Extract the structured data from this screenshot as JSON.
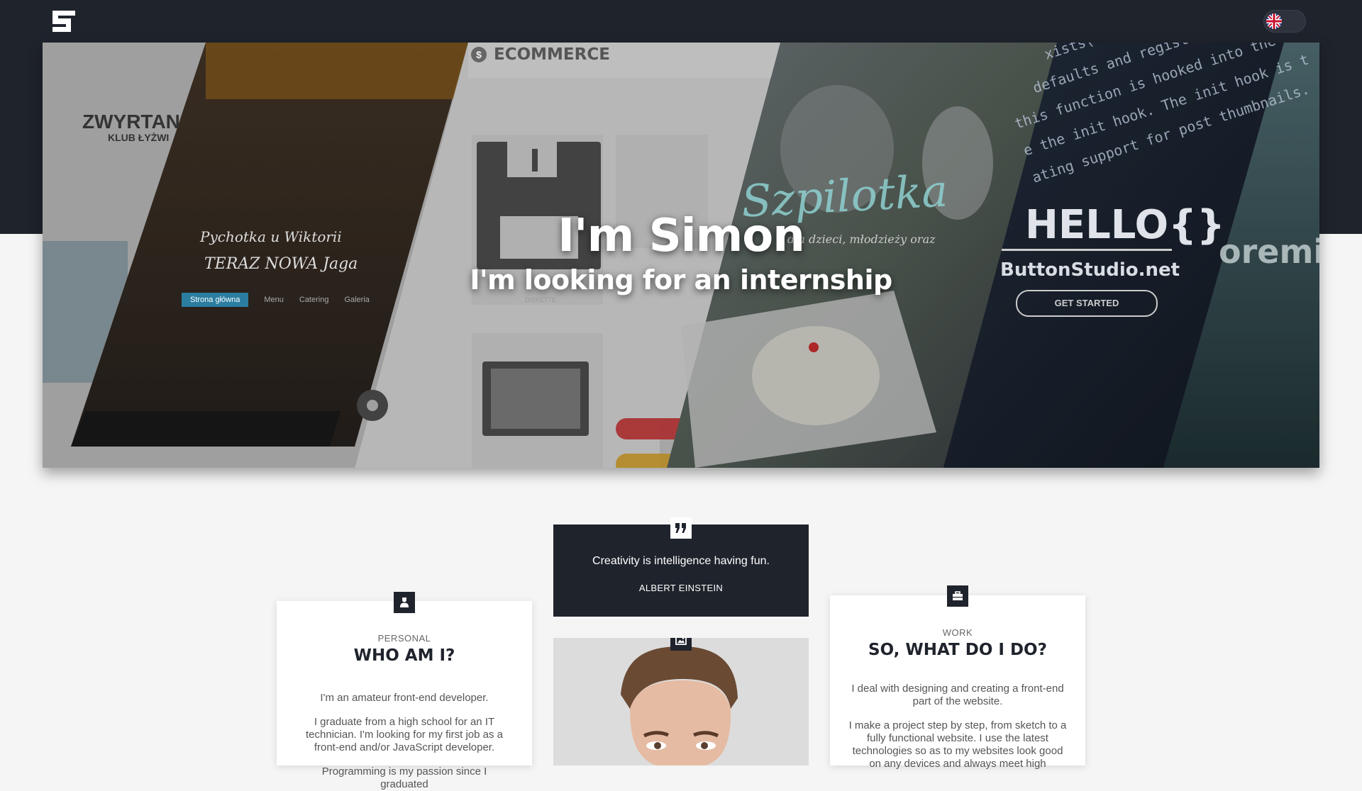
{
  "header": {
    "logo_icon": "g-logo-icon",
    "language_toggle": {
      "flag_icon": "uk-flag-icon"
    }
  },
  "hero": {
    "title": "I'm Simon",
    "subtitle": "I'm looking for an internship",
    "panels": {
      "zwyrtan": {
        "title": "ZWYRTAN",
        "subtitle": "KLUB ŁYŻWI",
        "script1": "Pychotka u Wiktorii",
        "script2": "TERAZ NOWA Jaga",
        "menu": [
          "Strona główna",
          "Menu",
          "Catering",
          "Galeria"
        ]
      },
      "ecommerce": {
        "title": "ECOMMERCE",
        "item_label": "DISKETTE"
      },
      "szpilotka": {
        "script": "Szpilotka",
        "caption": "dla dzieci, młodzieży oraz"
      },
      "hello": {
        "logo": "HELLO{}",
        "site": "ButtonStudio.net",
        "button": "GET STARTED",
        "code": [
          "xists( 'incode_st",
          "defaults and registers suppor",
          "this function is hooked into the af",
          "e the init hook. The init hook is t",
          "ating support for post thumbnails."
        ]
      },
      "lorem": {
        "text": "oremi"
      }
    }
  },
  "quote": {
    "icon": "quote-icon",
    "text": "Creativity is intelligence having fun.",
    "author": "ALBERT EINSTEIN"
  },
  "about": {
    "icon": "person-icon",
    "label": "PERSONAL",
    "title": "WHO AM I?",
    "paragraphs": [
      "I'm an amateur front-end developer.",
      "I graduate from a high school for an IT technician. I'm looking for my first job as a front-end and/or JavaScript developer.",
      "Programming is my passion since I graduated"
    ]
  },
  "photo": {
    "icon": "image-icon"
  },
  "work": {
    "icon": "briefcase-icon",
    "label": "WORK",
    "title": "SO, WHAT DO I DO?",
    "paragraphs": [
      "I deal with designing and creating a front-end part of the website.",
      "I make a project step by step, from sketch to a fully functional website. I use the latest technologies so as to my websites look good on any devices and always meet high"
    ]
  },
  "colors": {
    "dark": "#1f232c",
    "background": "#f5f5f5"
  }
}
